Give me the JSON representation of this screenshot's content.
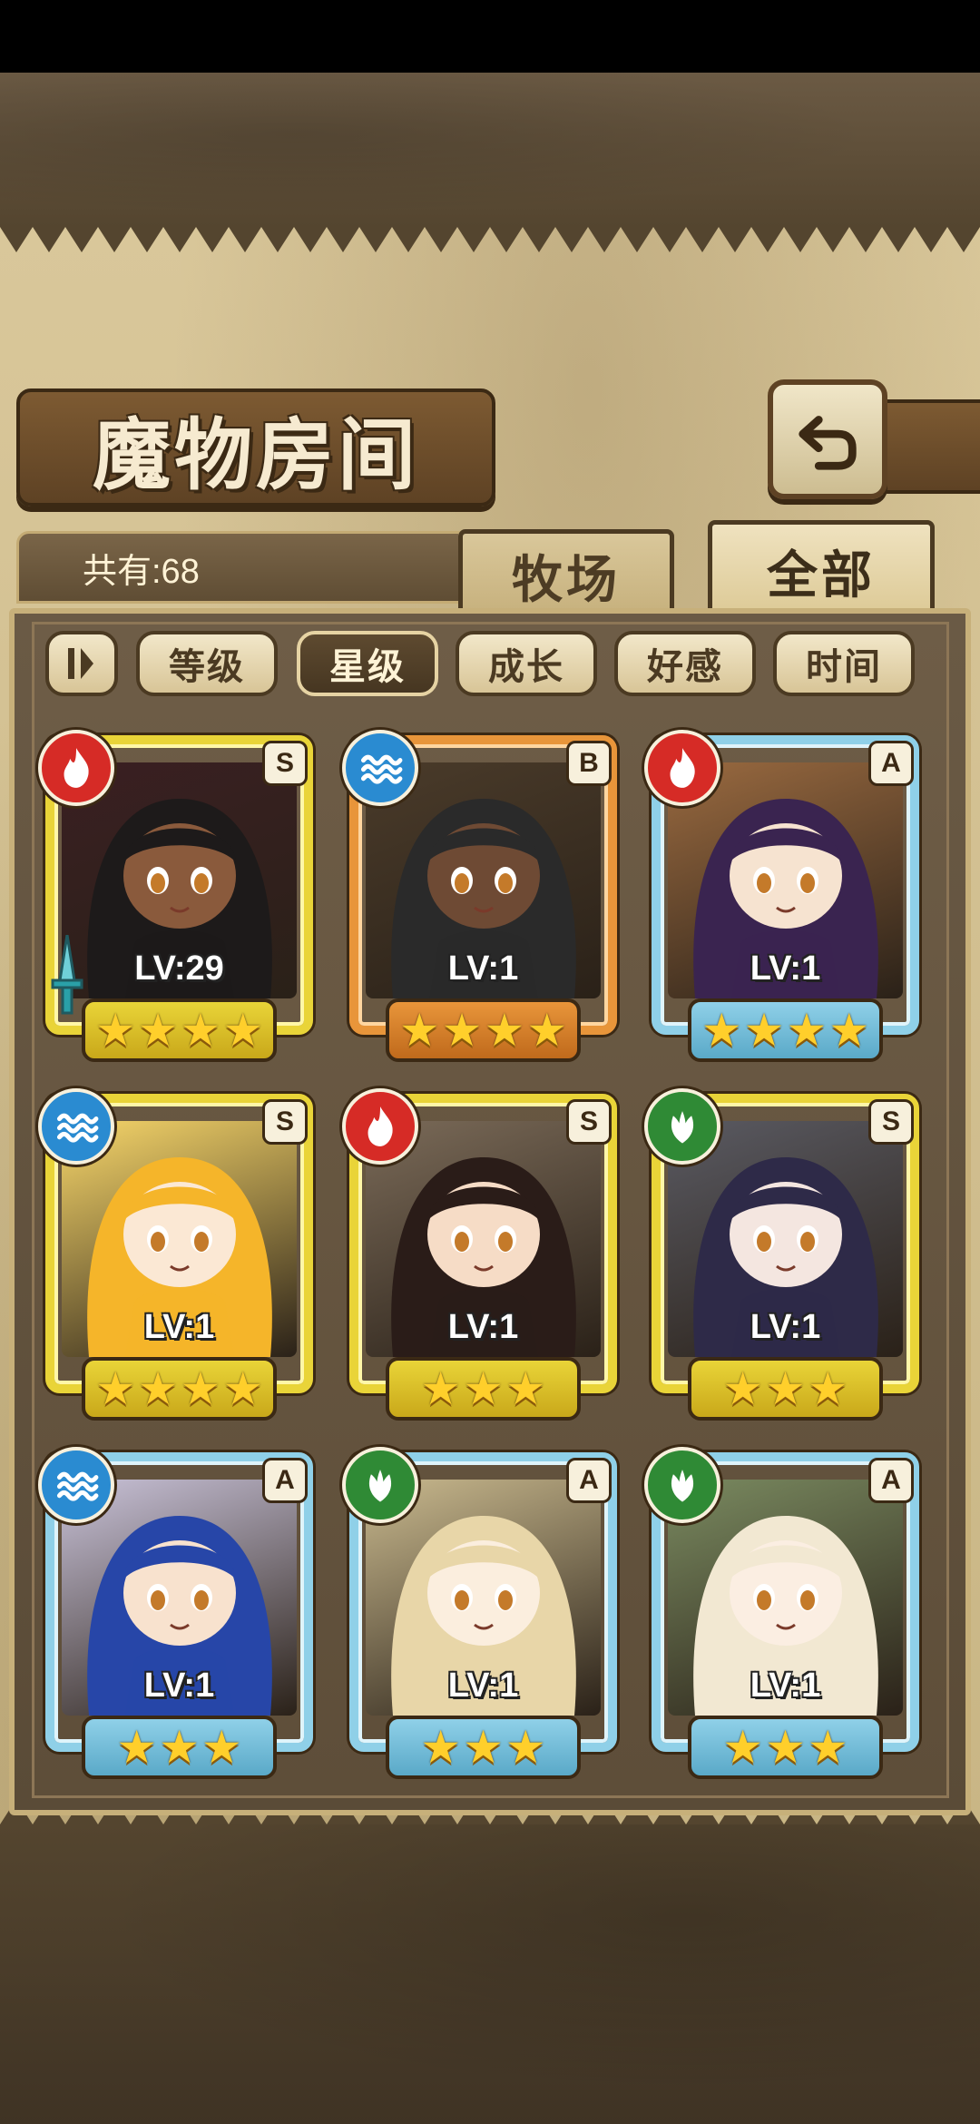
{
  "title": "魔物房间",
  "count_label": "共有:68",
  "tabs": {
    "ranch": "牧场",
    "all": "全部",
    "active": "全部"
  },
  "sort_buttons": [
    {
      "label": "等级",
      "active": false
    },
    {
      "label": "星级",
      "active": true
    },
    {
      "label": "成长",
      "active": false
    },
    {
      "label": "好感",
      "active": false
    },
    {
      "label": "时间",
      "active": false
    }
  ],
  "colors": {
    "S": "#e9d438",
    "A": "#8fd0e8",
    "B": "#e8953a",
    "fire": "#d62b26",
    "water": "#2a8bd1",
    "leaf": "#2f8a35"
  },
  "cards": [
    {
      "rank": "S",
      "element": "fire",
      "level": "LV:29",
      "stars": 4,
      "has_weapon": true,
      "hair": "#1d1a1a",
      "skin": "#8a5a3c",
      "bg": "#3a1f22"
    },
    {
      "rank": "B",
      "element": "water",
      "level": "LV:1",
      "stars": 4,
      "has_weapon": false,
      "hair": "#2a2a2a",
      "skin": "#6e4a34",
      "bg": "#4a3b2a"
    },
    {
      "rank": "A",
      "element": "fire",
      "level": "LV:1",
      "stars": 4,
      "has_weapon": false,
      "hair": "#3a2450",
      "skin": "#f6e3d0",
      "bg": "#9a6a40"
    },
    {
      "rank": "S",
      "element": "water",
      "level": "LV:1",
      "stars": 4,
      "has_weapon": false,
      "hair": "#f5b52a",
      "skin": "#fbe8d4",
      "bg": "#f7d66a"
    },
    {
      "rank": "S",
      "element": "fire",
      "level": "LV:1",
      "stars": 3,
      "has_weapon": false,
      "hair": "#2a1c18",
      "skin": "#f6dcc6",
      "bg": "#7a6a58"
    },
    {
      "rank": "S",
      "element": "leaf",
      "level": "LV:1",
      "stars": 3,
      "has_weapon": false,
      "hair": "#2e2a48",
      "skin": "#f4e6e0",
      "bg": "#5a5a62"
    },
    {
      "rank": "A",
      "element": "water",
      "level": "LV:1",
      "stars": 3,
      "has_weapon": false,
      "hair": "#2746a8",
      "skin": "#f8e2ce",
      "bg": "#c9c2d8"
    },
    {
      "rank": "A",
      "element": "leaf",
      "level": "LV:1",
      "stars": 3,
      "has_weapon": false,
      "hair": "#e8d6a8",
      "skin": "#fbeede",
      "bg": "#c9b98e"
    },
    {
      "rank": "A",
      "element": "leaf",
      "level": "LV:1",
      "stars": 3,
      "has_weapon": false,
      "hair": "#f2e8d2",
      "skin": "#fbeee2",
      "bg": "#7a8a60"
    }
  ]
}
